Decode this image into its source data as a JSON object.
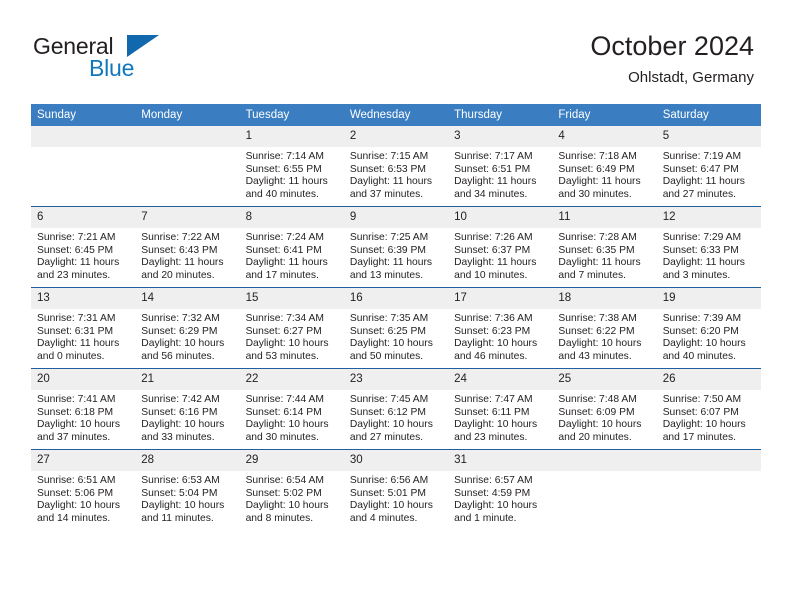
{
  "brand": {
    "name_part1": "General",
    "name_part2": "Blue",
    "logo_icon": "triangle-logo-icon"
  },
  "header": {
    "title": "October 2024",
    "subtitle": "Ohlstadt, Germany"
  },
  "colors": {
    "header_blue": "#3a7dc0",
    "row_divider": "#1f5fa0",
    "daynum_band": "#efefef",
    "brand_blue": "#1278be",
    "text": "#231f20"
  },
  "calendar": {
    "weekday_headers": [
      "Sunday",
      "Monday",
      "Tuesday",
      "Wednesday",
      "Thursday",
      "Friday",
      "Saturday"
    ],
    "weeks": [
      [
        {
          "day": "",
          "lines": [
            "",
            "",
            "",
            ""
          ]
        },
        {
          "day": "",
          "lines": [
            "",
            "",
            "",
            ""
          ]
        },
        {
          "day": "1",
          "lines": [
            "Sunrise: 7:14 AM",
            "Sunset: 6:55 PM",
            "Daylight: 11 hours",
            "and 40 minutes."
          ]
        },
        {
          "day": "2",
          "lines": [
            "Sunrise: 7:15 AM",
            "Sunset: 6:53 PM",
            "Daylight: 11 hours",
            "and 37 minutes."
          ]
        },
        {
          "day": "3",
          "lines": [
            "Sunrise: 7:17 AM",
            "Sunset: 6:51 PM",
            "Daylight: 11 hours",
            "and 34 minutes."
          ]
        },
        {
          "day": "4",
          "lines": [
            "Sunrise: 7:18 AM",
            "Sunset: 6:49 PM",
            "Daylight: 11 hours",
            "and 30 minutes."
          ]
        },
        {
          "day": "5",
          "lines": [
            "Sunrise: 7:19 AM",
            "Sunset: 6:47 PM",
            "Daylight: 11 hours",
            "and 27 minutes."
          ]
        }
      ],
      [
        {
          "day": "6",
          "lines": [
            "Sunrise: 7:21 AM",
            "Sunset: 6:45 PM",
            "Daylight: 11 hours",
            "and 23 minutes."
          ]
        },
        {
          "day": "7",
          "lines": [
            "Sunrise: 7:22 AM",
            "Sunset: 6:43 PM",
            "Daylight: 11 hours",
            "and 20 minutes."
          ]
        },
        {
          "day": "8",
          "lines": [
            "Sunrise: 7:24 AM",
            "Sunset: 6:41 PM",
            "Daylight: 11 hours",
            "and 17 minutes."
          ]
        },
        {
          "day": "9",
          "lines": [
            "Sunrise: 7:25 AM",
            "Sunset: 6:39 PM",
            "Daylight: 11 hours",
            "and 13 minutes."
          ]
        },
        {
          "day": "10",
          "lines": [
            "Sunrise: 7:26 AM",
            "Sunset: 6:37 PM",
            "Daylight: 11 hours",
            "and 10 minutes."
          ]
        },
        {
          "day": "11",
          "lines": [
            "Sunrise: 7:28 AM",
            "Sunset: 6:35 PM",
            "Daylight: 11 hours",
            "and 7 minutes."
          ]
        },
        {
          "day": "12",
          "lines": [
            "Sunrise: 7:29 AM",
            "Sunset: 6:33 PM",
            "Daylight: 11 hours",
            "and 3 minutes."
          ]
        }
      ],
      [
        {
          "day": "13",
          "lines": [
            "Sunrise: 7:31 AM",
            "Sunset: 6:31 PM",
            "Daylight: 11 hours",
            "and 0 minutes."
          ]
        },
        {
          "day": "14",
          "lines": [
            "Sunrise: 7:32 AM",
            "Sunset: 6:29 PM",
            "Daylight: 10 hours",
            "and 56 minutes."
          ]
        },
        {
          "day": "15",
          "lines": [
            "Sunrise: 7:34 AM",
            "Sunset: 6:27 PM",
            "Daylight: 10 hours",
            "and 53 minutes."
          ]
        },
        {
          "day": "16",
          "lines": [
            "Sunrise: 7:35 AM",
            "Sunset: 6:25 PM",
            "Daylight: 10 hours",
            "and 50 minutes."
          ]
        },
        {
          "day": "17",
          "lines": [
            "Sunrise: 7:36 AM",
            "Sunset: 6:23 PM",
            "Daylight: 10 hours",
            "and 46 minutes."
          ]
        },
        {
          "day": "18",
          "lines": [
            "Sunrise: 7:38 AM",
            "Sunset: 6:22 PM",
            "Daylight: 10 hours",
            "and 43 minutes."
          ]
        },
        {
          "day": "19",
          "lines": [
            "Sunrise: 7:39 AM",
            "Sunset: 6:20 PM",
            "Daylight: 10 hours",
            "and 40 minutes."
          ]
        }
      ],
      [
        {
          "day": "20",
          "lines": [
            "Sunrise: 7:41 AM",
            "Sunset: 6:18 PM",
            "Daylight: 10 hours",
            "and 37 minutes."
          ]
        },
        {
          "day": "21",
          "lines": [
            "Sunrise: 7:42 AM",
            "Sunset: 6:16 PM",
            "Daylight: 10 hours",
            "and 33 minutes."
          ]
        },
        {
          "day": "22",
          "lines": [
            "Sunrise: 7:44 AM",
            "Sunset: 6:14 PM",
            "Daylight: 10 hours",
            "and 30 minutes."
          ]
        },
        {
          "day": "23",
          "lines": [
            "Sunrise: 7:45 AM",
            "Sunset: 6:12 PM",
            "Daylight: 10 hours",
            "and 27 minutes."
          ]
        },
        {
          "day": "24",
          "lines": [
            "Sunrise: 7:47 AM",
            "Sunset: 6:11 PM",
            "Daylight: 10 hours",
            "and 23 minutes."
          ]
        },
        {
          "day": "25",
          "lines": [
            "Sunrise: 7:48 AM",
            "Sunset: 6:09 PM",
            "Daylight: 10 hours",
            "and 20 minutes."
          ]
        },
        {
          "day": "26",
          "lines": [
            "Sunrise: 7:50 AM",
            "Sunset: 6:07 PM",
            "Daylight: 10 hours",
            "and 17 minutes."
          ]
        }
      ],
      [
        {
          "day": "27",
          "lines": [
            "Sunrise: 6:51 AM",
            "Sunset: 5:06 PM",
            "Daylight: 10 hours",
            "and 14 minutes."
          ]
        },
        {
          "day": "28",
          "lines": [
            "Sunrise: 6:53 AM",
            "Sunset: 5:04 PM",
            "Daylight: 10 hours",
            "and 11 minutes."
          ]
        },
        {
          "day": "29",
          "lines": [
            "Sunrise: 6:54 AM",
            "Sunset: 5:02 PM",
            "Daylight: 10 hours",
            "and 8 minutes."
          ]
        },
        {
          "day": "30",
          "lines": [
            "Sunrise: 6:56 AM",
            "Sunset: 5:01 PM",
            "Daylight: 10 hours",
            "and 4 minutes."
          ]
        },
        {
          "day": "31",
          "lines": [
            "Sunrise: 6:57 AM",
            "Sunset: 4:59 PM",
            "Daylight: 10 hours",
            "and 1 minute."
          ]
        },
        {
          "day": "",
          "lines": [
            "",
            "",
            "",
            ""
          ]
        },
        {
          "day": "",
          "lines": [
            "",
            "",
            "",
            ""
          ]
        }
      ]
    ]
  }
}
